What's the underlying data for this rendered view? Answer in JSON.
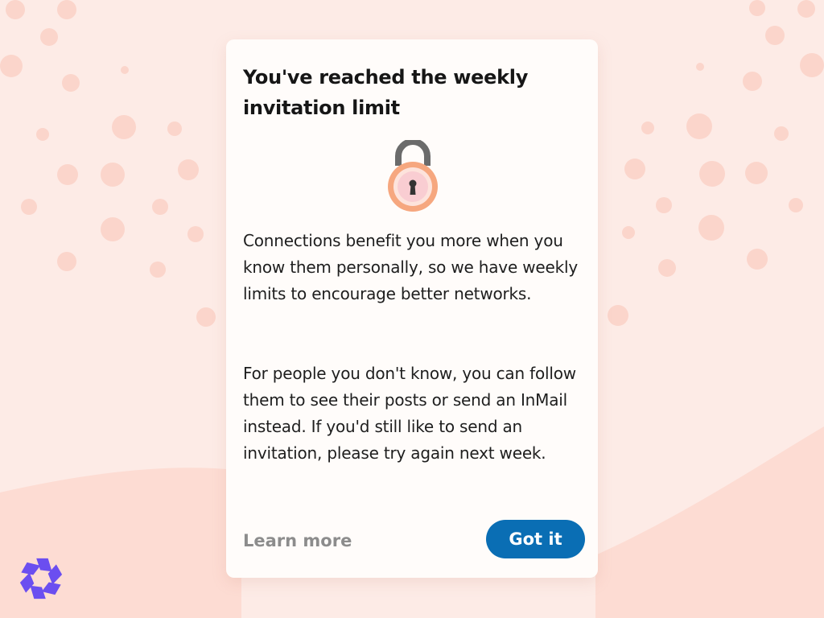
{
  "dialog": {
    "title": "You've reached the weekly invitation limit",
    "paragraph_1": "Connections benefit you more when you know them personally, so we have weekly limits to encourage better networks.",
    "paragraph_2": "For people you don't know, you can follow them to see their posts or send an InMail instead. If you'd still like to send an invitation, please try again next week.",
    "learn_more_label": "Learn more",
    "got_it_label": "Got it",
    "icon": "padlock-icon"
  },
  "branding": {
    "icon": "aperture-logo-icon"
  },
  "colors": {
    "background": "#fdebe6",
    "dots": "#fbd5cb",
    "card": "#fffcfa",
    "primary_button": "#0a6eb4",
    "link_text": "#8c8c8c",
    "lock_ring": "#f6a77f",
    "lock_shackle": "#6b6b6b",
    "logo": "#6b4ef0"
  }
}
